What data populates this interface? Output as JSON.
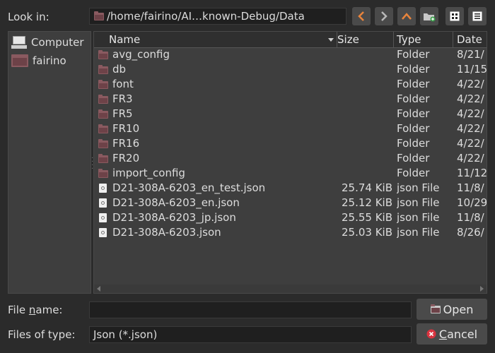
{
  "toolbar": {
    "look_in_label": "Look in:",
    "path": "/home/fairino/AI…known-Debug/Data"
  },
  "sidebar": {
    "items": [
      {
        "label": "Computer",
        "icon": "computer-icon"
      },
      {
        "label": "fairino",
        "icon": "home-folder-icon"
      }
    ]
  },
  "filelist": {
    "columns": [
      "Name",
      "Size",
      "Type",
      "Date"
    ],
    "rows": [
      {
        "name": "avg_config",
        "size": "",
        "type": "Folder",
        "date": "8/21/",
        "icon": "folder-icon"
      },
      {
        "name": "db",
        "size": "",
        "type": "Folder",
        "date": "11/15",
        "icon": "folder-icon"
      },
      {
        "name": "font",
        "size": "",
        "type": "Folder",
        "date": "4/22/",
        "icon": "folder-icon"
      },
      {
        "name": "FR3",
        "size": "",
        "type": "Folder",
        "date": "4/22/",
        "icon": "folder-icon"
      },
      {
        "name": "FR5",
        "size": "",
        "type": "Folder",
        "date": "4/22/",
        "icon": "folder-icon"
      },
      {
        "name": "FR10",
        "size": "",
        "type": "Folder",
        "date": "4/22/",
        "icon": "folder-icon"
      },
      {
        "name": "FR16",
        "size": "",
        "type": "Folder",
        "date": "4/22/",
        "icon": "folder-icon"
      },
      {
        "name": "FR20",
        "size": "",
        "type": "Folder",
        "date": "4/22/",
        "icon": "folder-icon"
      },
      {
        "name": "import_config",
        "size": "",
        "type": "Folder",
        "date": "11/12",
        "icon": "folder-icon"
      },
      {
        "name": "D21-308A-6203_en_test.json",
        "size": "25.74 KiB",
        "type": "json File",
        "date": "11/8/",
        "icon": "json-file-icon"
      },
      {
        "name": "D21-308A-6203_en.json",
        "size": "25.12 KiB",
        "type": "json File",
        "date": "10/29",
        "icon": "json-file-icon"
      },
      {
        "name": "D21-308A-6203_jp.json",
        "size": "25.55 KiB",
        "type": "json File",
        "date": "11/8/",
        "icon": "json-file-icon"
      },
      {
        "name": "D21-308A-6203.json",
        "size": "25.03 KiB",
        "type": "json File",
        "date": "8/26/",
        "icon": "json-file-icon"
      }
    ]
  },
  "bottom": {
    "filename_label_pre": "File ",
    "filename_label_u": "n",
    "filename_label_post": "ame:",
    "filename_value": "",
    "filetype_label": "Files of type:",
    "filetype_value": "Json (*.json)",
    "open_label": "Open",
    "cancel_label_u": "C",
    "cancel_label_rest": "ancel"
  },
  "colors": {
    "nav_arrow": "#e8843c",
    "folder": "#8a5a60",
    "cancel_icon": "#d9333f"
  }
}
